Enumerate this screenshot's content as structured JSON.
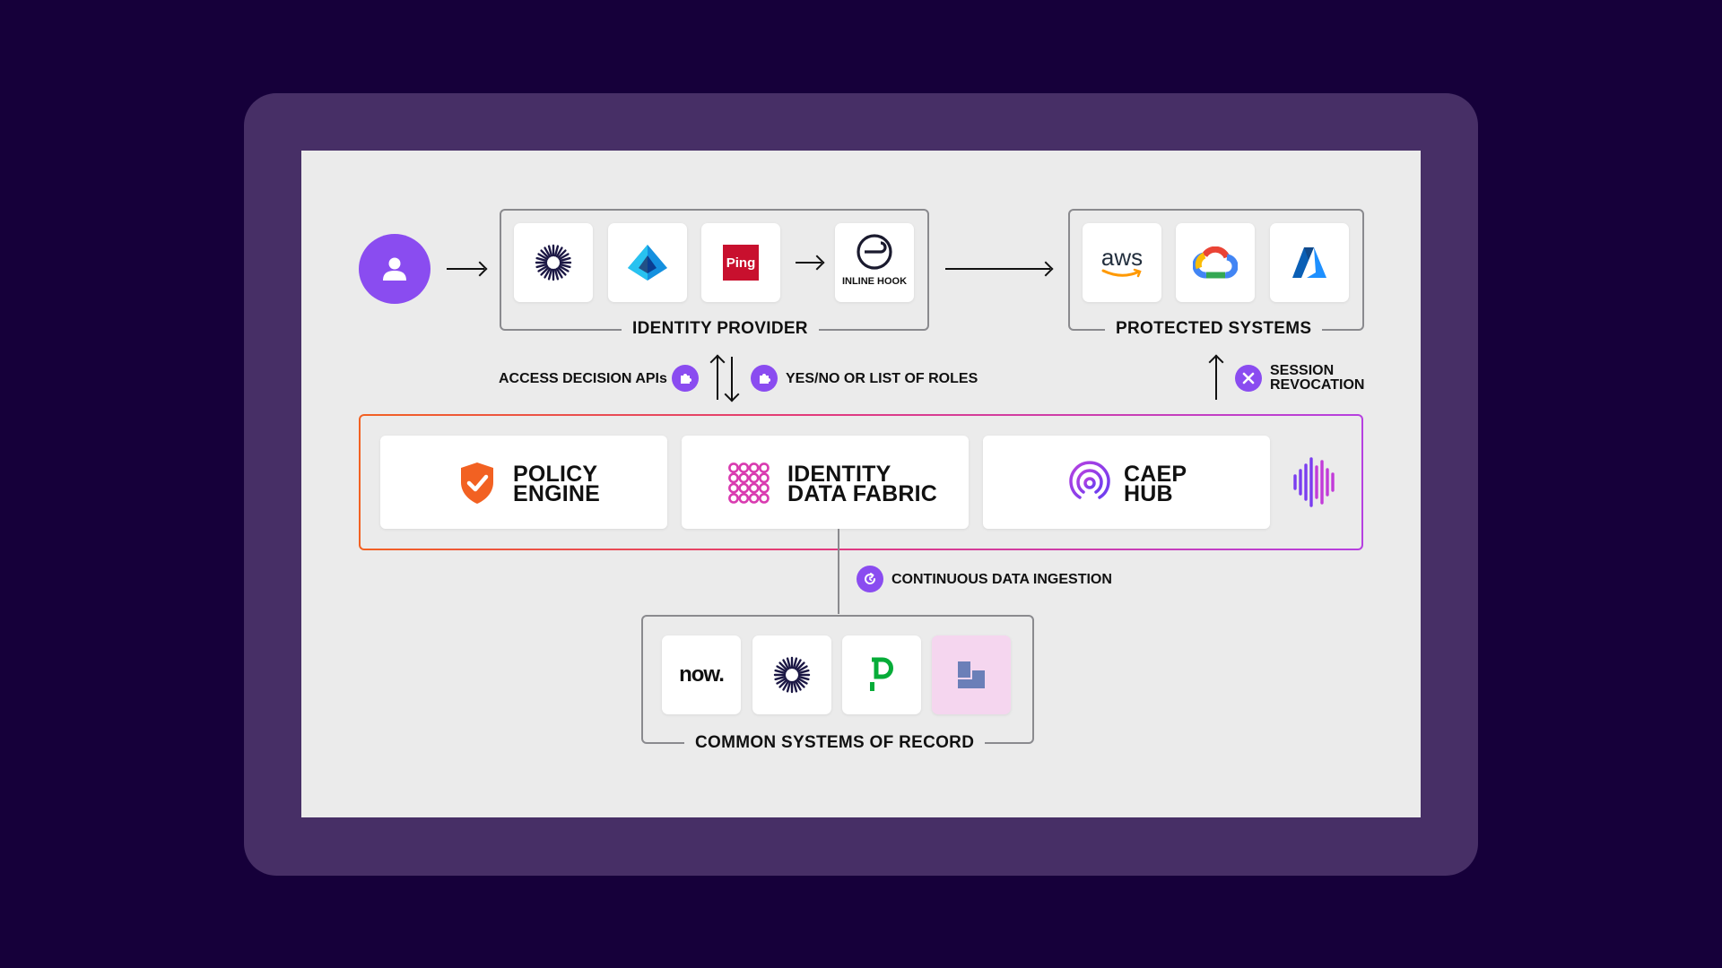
{
  "identity_provider": {
    "label": "IDENTITY PROVIDER",
    "inline_hook_label": "INLINE HOOK",
    "ping_logo_text": "Ping"
  },
  "protected_systems": {
    "label": "PROTECTED SYSTEMS",
    "aws_logo_text": "aws"
  },
  "connections": {
    "access_decision": "ACCESS DECISION APIs",
    "yes_no": "YES/NO OR LIST OF ROLES",
    "session_revocation_line1": "SESSION",
    "session_revocation_line2": "REVOCATION",
    "continuous_ingestion": "CONTINUOUS DATA INGESTION"
  },
  "platform": {
    "policy_engine_line1": "POLICY",
    "policy_engine_line2": "ENGINE",
    "data_fabric_line1": "IDENTITY",
    "data_fabric_line2": "DATA FABRIC",
    "caep_line1": "CAEP",
    "caep_line2": "HUB"
  },
  "systems_of_record": {
    "label": "COMMON SYSTEMS OF RECORD",
    "servicenow_logo_text": "now."
  },
  "colors": {
    "background": "#16003a",
    "frame": "#472f66",
    "canvas": "#ebebeb",
    "accent_purple": "#8a4cf0",
    "policy_orange": "#f26122",
    "fabric_pink": "#d93bb0"
  }
}
